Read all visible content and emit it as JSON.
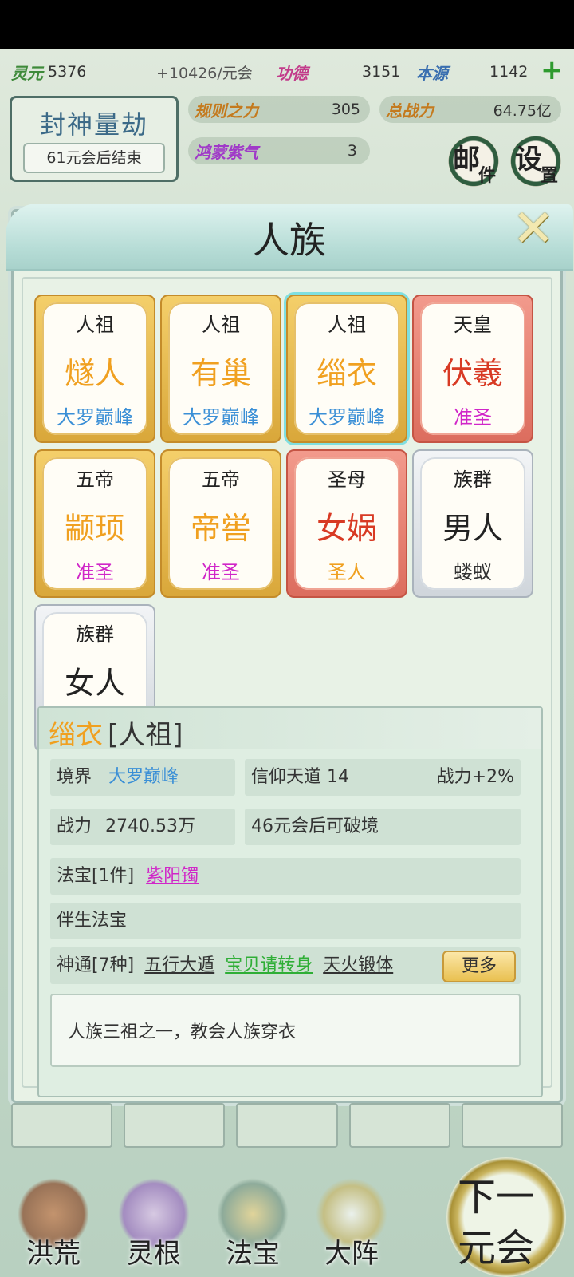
{
  "resources": {
    "lingyuan": {
      "label": "灵元",
      "value": "5376"
    },
    "rate": "+10426/元会",
    "gongde": {
      "label": "功德",
      "value": "3151"
    },
    "benyuan": {
      "label": "本源",
      "value": "1142"
    },
    "guize": {
      "label": "规则之力",
      "value": "305"
    },
    "zongzhanli": {
      "label": "总战力",
      "value": "64.75亿"
    },
    "hongmeng": {
      "label": "鸿蒙紫气",
      "value": "3"
    }
  },
  "event": {
    "title": "封神量劫",
    "subtitle": "61元会后结束"
  },
  "buttons": {
    "mail": {
      "big": "邮",
      "small": "件"
    },
    "settings": {
      "big": "设",
      "small": "置"
    }
  },
  "modal": {
    "title": "人族",
    "cards": [
      {
        "title": "人祖",
        "name": "燧人",
        "realm": "大罗巅峰"
      },
      {
        "title": "人祖",
        "name": "有巢",
        "realm": "大罗巅峰"
      },
      {
        "title": "人祖",
        "name": "缁衣",
        "realm": "大罗巅峰"
      },
      {
        "title": "天皇",
        "name": "伏羲",
        "realm": "准圣"
      },
      {
        "title": "五帝",
        "name": "颛顼",
        "realm": "准圣"
      },
      {
        "title": "五帝",
        "name": "帝喾",
        "realm": "准圣"
      },
      {
        "title": "圣母",
        "name": "女娲",
        "realm": "圣人"
      },
      {
        "title": "族群",
        "name": "男人",
        "realm": "蝼蚁"
      },
      {
        "title": "族群",
        "name": "女人",
        "realm": ""
      }
    ],
    "detail": {
      "name": "缁衣",
      "rank": "[人祖]",
      "jingjie_label": "境界",
      "jingjie_value": "大罗巅峰",
      "xinyang": "信仰天道 14",
      "zhanli_bonus": "战力+2%",
      "zhanli_label": "战力",
      "zhanli_value": "2740.53万",
      "breakthrough": "46元会后可破境",
      "fabao_label": "法宝[1件]",
      "fabao_item": "紫阳镯",
      "bansheng": "伴生法宝",
      "shentong_label": "神通[7种]",
      "shentong": [
        "五行大遁",
        "宝贝请转身",
        "天火锻体"
      ],
      "more": "更多",
      "description": "人族三祖之一，教会人族穿衣"
    }
  },
  "bottom_nav": [
    "洪荒",
    "灵根",
    "法宝",
    "大阵"
  ],
  "next": {
    "line1": "下一",
    "line2": "元会"
  }
}
